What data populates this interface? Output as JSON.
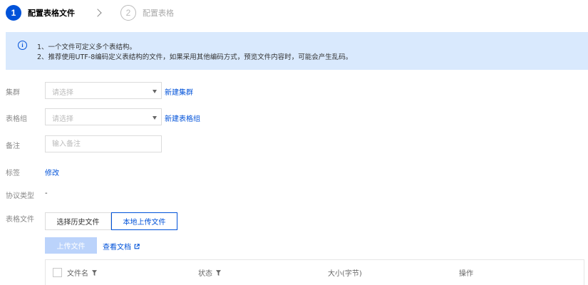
{
  "steps": [
    {
      "number": "1",
      "label": "配置表格文件"
    },
    {
      "number": "2",
      "label": "配置表格"
    }
  ],
  "notice": {
    "icon": "info-icon",
    "line1": "1、一个文件可定义多个表结构。",
    "line2": "2、推荐使用UTF-8编码定义表结构的文件，如果采用其他编码方式，预览文件内容时，可能会产生乱码。"
  },
  "form": {
    "cluster": {
      "label": "集群",
      "placeholder": "请选择",
      "link": "新建集群"
    },
    "table_group": {
      "label": "表格组",
      "placeholder": "请选择",
      "link": "新建表格组"
    },
    "remark": {
      "label": "备注",
      "placeholder": "输入备注"
    },
    "tags": {
      "label": "标签",
      "link": "修改"
    },
    "protocol": {
      "label": "协议类型",
      "value": "-"
    },
    "table_file": {
      "label": "表格文件",
      "tabs": [
        "选择历史文件",
        "本地上传文件"
      ],
      "selected_tab": "本地上传文件",
      "upload_button": "上传文件",
      "doc_link": "查看文档"
    }
  },
  "table": {
    "columns": [
      "文件名",
      "状态",
      "大小(字节)",
      "操作"
    ]
  },
  "colors": {
    "primary": "#0052d9",
    "notice_bg": "#d9e9fd",
    "upload_disabled": "#bbd3fb"
  }
}
